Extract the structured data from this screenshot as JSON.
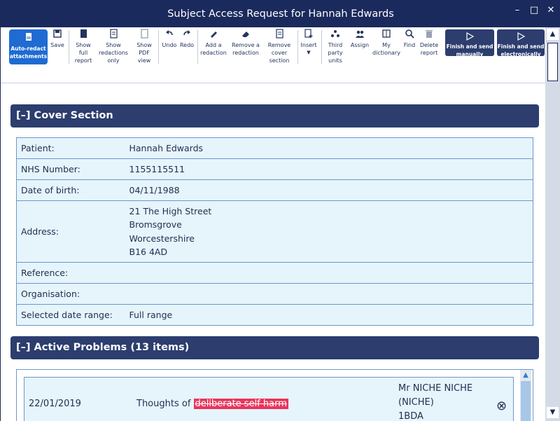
{
  "window": {
    "title": "Subject Access Request for Hannah Edwards",
    "controls": {
      "minimize": "–",
      "maximize": "□",
      "close": "✕"
    }
  },
  "toolbar": {
    "auto_redact": "Auto-redact attachments",
    "save": "Save",
    "show_full_report": "Show full report",
    "show_redactions_only": "Show redactions only",
    "show_pdf_view": "Show PDF view",
    "undo": "Undo",
    "redo": "Redo",
    "add_redaction": "Add a redaction",
    "remove_redaction": "Remove a redaction",
    "remove_cover_section": "Remove cover section",
    "insert": "Insert",
    "third_party_units": "Third party units",
    "assign": "Assign",
    "my_dictionary": "My dictionary",
    "find": "Find",
    "delete_report": "Delete report",
    "finish_manually": "Finish and send manually",
    "finish_electronically": "Finish and send electronically"
  },
  "cover_section": {
    "heading": "[–]  Cover Section",
    "rows": [
      {
        "label": "Patient:",
        "value": "Hannah Edwards"
      },
      {
        "label": "NHS Number:",
        "value": "1155115511"
      },
      {
        "label": "Date of birth:",
        "value": "04/11/1988"
      }
    ],
    "address_label": "Address:",
    "address_lines": [
      "21 The High Street",
      "Bromsgrove",
      "Worcestershire",
      "B16 4AD"
    ],
    "rows_after": [
      {
        "label": "Reference:",
        "value": ""
      },
      {
        "label": "Organisation:",
        "value": ""
      },
      {
        "label": "Selected date range:",
        "value": "Full range"
      }
    ]
  },
  "active_problems": {
    "heading": "[–]  Active Problems (13 items)",
    "items": [
      {
        "date": "22/01/2019",
        "prefix": "Thoughts of ",
        "redacted": "deliberate self harm",
        "author_lines": [
          "Mr NICHE NICHE",
          "(NICHE)",
          "1BDA"
        ]
      }
    ]
  }
}
